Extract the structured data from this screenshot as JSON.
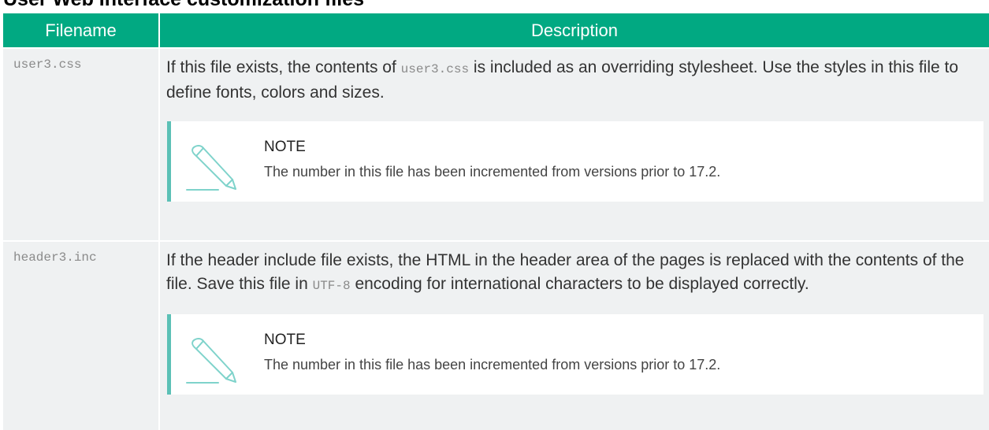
{
  "page": {
    "title": "User Web Interface customization files"
  },
  "table": {
    "headers": {
      "filename": "Filename",
      "description": "Description"
    },
    "rows": [
      {
        "filename": "user3.css",
        "desc_before": "If this file exists, the contents of ",
        "desc_code": "user3.css",
        "desc_after": " is included as an overriding stylesheet. Use the styles in this file to define fonts, colors and sizes.",
        "note": {
          "icon": "pencil-icon",
          "title": "NOTE",
          "body": "The number in this file has been incremented from versions prior to 17.2."
        }
      },
      {
        "filename": "header3.inc",
        "desc_before": "If the header include file exists, the HTML in the header area of the pages is replaced with the contents of the file. Save this file in ",
        "desc_code": "UTF-8",
        "desc_after": " encoding for international characters to be displayed correctly.",
        "note": {
          "icon": "pencil-icon",
          "title": "NOTE",
          "body": "The number in this file has been incremented from versions prior to 17.2."
        }
      }
    ]
  },
  "colors": {
    "header_bg": "#01a982",
    "row_bg": "#eff1f2",
    "note_accent": "#5bc0b6",
    "code_text": "#8a8a8a"
  }
}
